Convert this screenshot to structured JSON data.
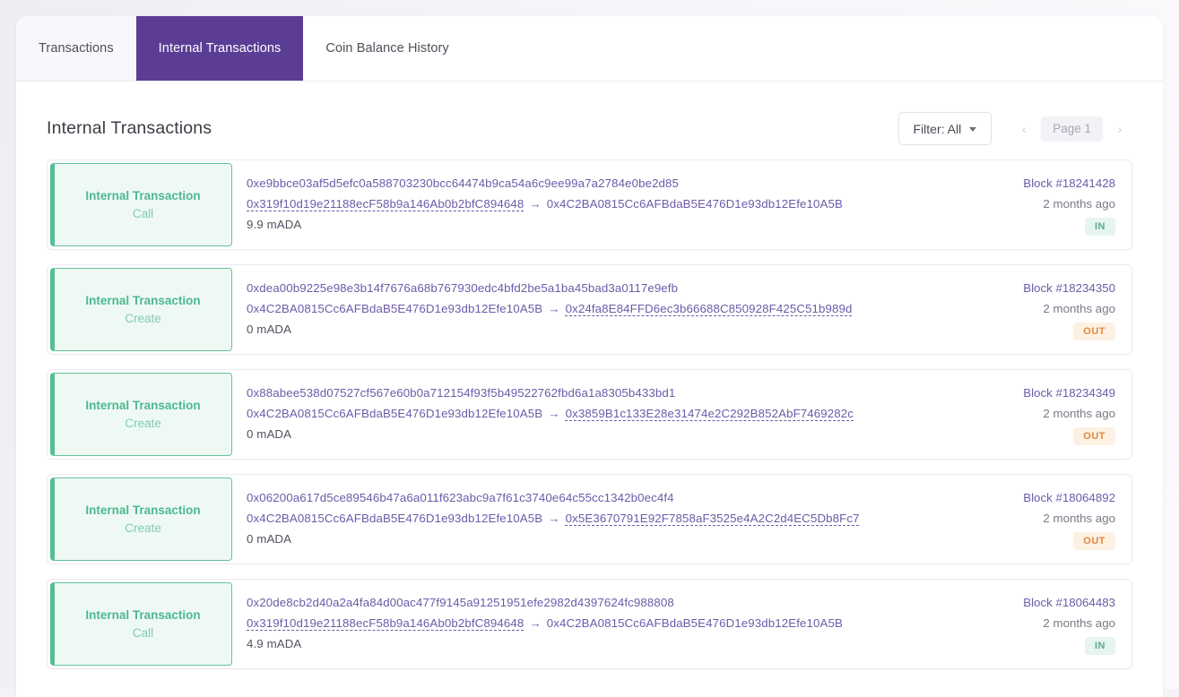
{
  "tabs": [
    {
      "label": "Transactions",
      "active": false,
      "style": "inactive-left"
    },
    {
      "label": "Internal Transactions",
      "active": true,
      "style": "active"
    },
    {
      "label": "Coin Balance History",
      "active": false,
      "style": "plain"
    }
  ],
  "header": {
    "title": "Internal Transactions",
    "filter_label": "Filter: All",
    "pager": {
      "prev_glyph": "‹",
      "next_glyph": "›",
      "page_label": "Page 1"
    }
  },
  "colors": {
    "accent_purple": "#5c3d96",
    "link_purple": "#6d5ba8",
    "green_border": "#55be95",
    "green_bg": "#eff9f4",
    "green_text": "#4cb891",
    "badge_in_bg": "#e6f5f0",
    "badge_in_text": "#5aa897",
    "badge_out_bg": "#fdf1e3",
    "badge_out_text": "#e2893f"
  },
  "arrow_glyph": "→",
  "transactions": [
    {
      "type_title": "Internal Transaction",
      "type_sub": "Call",
      "hash": "0xe9bbce03af5d5efc0a588703230bcc64474b9ca54a6c9ee99a7a2784e0be2d85",
      "from": "0x319f10d19e21188ecF58b9a146Ab0b2bfC894648",
      "from_is_link": true,
      "to": "0x4C2BA0815Cc6AFBdaB5E476D1e93db12Efe10A5B",
      "to_is_link": false,
      "value": "9.9 mADA",
      "block": "Block #18241428",
      "age": "2 months ago",
      "direction": "IN"
    },
    {
      "type_title": "Internal Transaction",
      "type_sub": "Create",
      "hash": "0xdea00b9225e98e3b14f7676a68b767930edc4bfd2be5a1ba45bad3a0117e9efb",
      "from": "0x4C2BA0815Cc6AFBdaB5E476D1e93db12Efe10A5B",
      "from_is_link": false,
      "to": "0x24fa8E84FFD6ec3b66688C850928F425C51b989d",
      "to_is_link": true,
      "value": "0 mADA",
      "block": "Block #18234350",
      "age": "2 months ago",
      "direction": "OUT"
    },
    {
      "type_title": "Internal Transaction",
      "type_sub": "Create",
      "hash": "0x88abee538d07527cf567e60b0a712154f93f5b49522762fbd6a1a8305b433bd1",
      "from": "0x4C2BA0815Cc6AFBdaB5E476D1e93db12Efe10A5B",
      "from_is_link": false,
      "to": "0x3859B1c133E28e31474e2C292B852AbF7469282c",
      "to_is_link": true,
      "value": "0 mADA",
      "block": "Block #18234349",
      "age": "2 months ago",
      "direction": "OUT"
    },
    {
      "type_title": "Internal Transaction",
      "type_sub": "Create",
      "hash": "0x06200a617d5ce89546b47a6a011f623abc9a7f61c3740e64c55cc1342b0ec4f4",
      "from": "0x4C2BA0815Cc6AFBdaB5E476D1e93db12Efe10A5B",
      "from_is_link": false,
      "to": "0x5E3670791E92F7858aF3525e4A2C2d4EC5Db8Fc7",
      "to_is_link": true,
      "value": "0 mADA",
      "block": "Block #18064892",
      "age": "2 months ago",
      "direction": "OUT"
    },
    {
      "type_title": "Internal Transaction",
      "type_sub": "Call",
      "hash": "0x20de8cb2d40a2a4fa84d00ac477f9145a91251951efe2982d4397624fc988808",
      "from": "0x319f10d19e21188ecF58b9a146Ab0b2bfC894648",
      "from_is_link": true,
      "to": "0x4C2BA0815Cc6AFBdaB5E476D1e93db12Efe10A5B",
      "to_is_link": false,
      "value": "4.9 mADA",
      "block": "Block #18064483",
      "age": "2 months ago",
      "direction": "IN"
    }
  ]
}
